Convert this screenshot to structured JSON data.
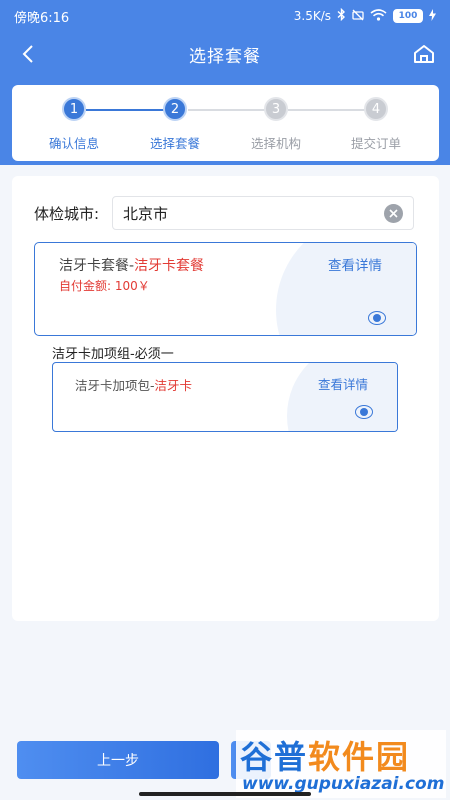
{
  "status_bar": {
    "time": "傍晚6:16",
    "speed": "3.5K/s",
    "battery": "100"
  },
  "nav": {
    "title": "选择套餐"
  },
  "steps": [
    {
      "number": "1",
      "label": "确认信息",
      "state": "done"
    },
    {
      "number": "2",
      "label": "选择套餐",
      "state": "active"
    },
    {
      "number": "3",
      "label": "选择机构",
      "state": "pending"
    },
    {
      "number": "4",
      "label": "提交订单",
      "state": "pending"
    }
  ],
  "city": {
    "label": "体检城市:",
    "value": "北京市"
  },
  "package": {
    "name_prefix": "洁牙卡套餐-",
    "name_highlight": "洁牙卡套餐",
    "price_label": "自付金额:",
    "price_value": "100￥",
    "detail_link": "查看详情",
    "selected": true
  },
  "addon_group": {
    "title": "洁牙卡加项组-必须一",
    "item": {
      "name_prefix": "洁牙卡加项包-",
      "name_highlight": "洁牙卡",
      "detail_link": "查看详情",
      "selected": true
    }
  },
  "footer": {
    "prev_button": "上一步"
  },
  "watermark": {
    "title_part1": "谷普",
    "title_part2": "软件园",
    "url": "www.gupuxiazai.com"
  },
  "colors": {
    "primary": "#3a78d8",
    "header": "#4a85e6",
    "highlight": "#e23b35"
  }
}
